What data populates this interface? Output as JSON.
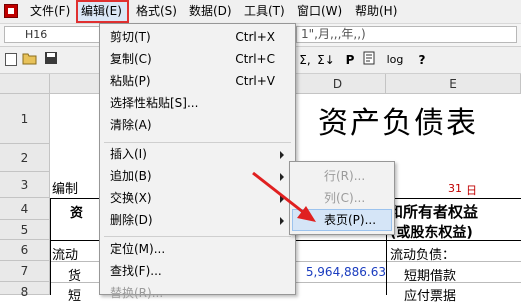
{
  "menubar": {
    "items": [
      {
        "label": "文件(F)"
      },
      {
        "label": "编辑(E)"
      },
      {
        "label": "格式(S)"
      },
      {
        "label": "数据(D)"
      },
      {
        "label": "工具(T)"
      },
      {
        "label": "窗口(W)"
      },
      {
        "label": "帮助(H)"
      }
    ]
  },
  "formula_bar": {
    "cell_ref": "H16",
    "content": "1\",月,,,年,,)"
  },
  "toolbar": {
    "sigma1": "Σ,",
    "sigma2": "Σ↓",
    "p": "P",
    "log": "log",
    "help": "?"
  },
  "grid": {
    "columns": [
      "D",
      "E"
    ],
    "rows": [
      "1",
      "2",
      "3",
      "4",
      "5",
      "6",
      "7",
      "8"
    ],
    "title": "资产负债表",
    "r3_left": "编制",
    "r3_date_num": "31",
    "r3_date_char": "日",
    "r4_left": "资",
    "r4_right": "和所有者权益",
    "r5_right": "(或股东权益)",
    "r6_left": "流动",
    "r6_right": "流动负债：",
    "r7_left": "货",
    "r7_value": "5,964,886.63",
    "r7_right": "短期借款",
    "r8_left": "短",
    "r8_right": "应付票据"
  },
  "edit_menu": {
    "items": [
      {
        "label": "剪切(T)",
        "shortcut": "Ctrl+X"
      },
      {
        "label": "复制(C)",
        "shortcut": "Ctrl+C"
      },
      {
        "label": "粘贴(P)",
        "shortcut": "Ctrl+V"
      },
      {
        "label": "选择性粘贴[S]..."
      },
      {
        "label": "清除(A)"
      },
      {
        "label": "插入(I)"
      },
      {
        "label": "追加(B)"
      },
      {
        "label": "交换(X)"
      },
      {
        "label": "删除(D)"
      },
      {
        "label": "定位(M)..."
      },
      {
        "label": "查找(F)..."
      },
      {
        "label": "替换(R)..."
      }
    ]
  },
  "append_submenu": {
    "items": [
      {
        "label": "行(R)..."
      },
      {
        "label": "列(C)..."
      },
      {
        "label": "表页(P)..."
      }
    ]
  },
  "colors": {
    "highlight_border": "#e03030",
    "arrow": "#e02020",
    "link_value": "#1a3cbf"
  }
}
